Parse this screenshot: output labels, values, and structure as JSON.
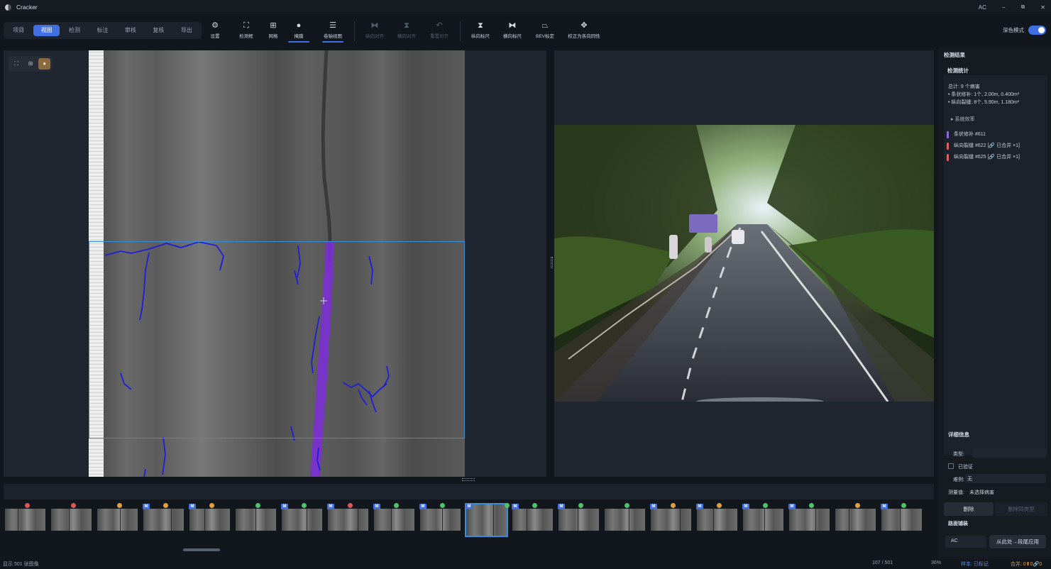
{
  "app": {
    "title": "Cracker",
    "user": "AC"
  },
  "window_controls": {
    "minimize": "−",
    "maximize": "⧉",
    "close": "✕"
  },
  "tabs": [
    {
      "label": "项目",
      "active": false
    },
    {
      "label": "视图",
      "active": true
    },
    {
      "label": "检测",
      "active": false
    },
    {
      "label": "标注",
      "active": false
    },
    {
      "label": "审核",
      "active": false
    },
    {
      "label": "复核",
      "active": false
    },
    {
      "label": "导出",
      "active": false
    }
  ],
  "tools": {
    "settings": "设置",
    "detect_box": "检测框",
    "grid": "网格",
    "mask": "掩膜",
    "roll_view": "卷轴视图",
    "long_align": "纵向对齐",
    "cross_align": "横向对齐",
    "reset_align": "重置对齐",
    "long_ruler": "纵向标尺",
    "cross_ruler": "横向标尺",
    "bev_calib": "BEV标定",
    "correct_to_normal": "校正为各向同性"
  },
  "dark_mode": {
    "label": "深色模式",
    "on": true
  },
  "sidebar": {
    "header": "检测结果",
    "stats_title": "检测统计",
    "total": "总计: 9 个病害",
    "line1": "• 条状修补: 1个, 2.00m, 0.400m²",
    "line2": "• 纵向裂缝: 8个, 5.90m, 1.180m²",
    "efficiency": "▸  系统效率",
    "defects": [
      {
        "label": "条状修补 #611",
        "color": "#8a6bd6"
      },
      {
        "label": "纵向裂缝 #622  [🔗 已合并 ×1]",
        "color": "#e0605e"
      },
      {
        "label": "纵向裂缝 #625  [🔗 已合并 ×1]",
        "color": "#e0605e"
      }
    ],
    "detail_title": "详细信息",
    "type_label": "类型:",
    "verified_label": "已验证",
    "difficulty_label": "难例:",
    "difficulty_value": "无",
    "measure_label": "测量值:",
    "measure_value": "未选择病害",
    "delete_btn": "删除",
    "delete_same_btn": "删除同类型",
    "pavement_title": "路面铺装",
    "pavement_value": "AC",
    "apply_btn": "从此处→段尾应用"
  },
  "thumb_status_colors": {
    "red": "#e05555",
    "orange": "#e0a040",
    "green": "#4cc46a"
  },
  "thumb_badge": "M",
  "thumbnails": [
    {
      "dot": "red",
      "badge": false
    },
    {
      "dot": "red",
      "badge": false
    },
    {
      "dot": "orange",
      "badge": false
    },
    {
      "dot": "orange",
      "badge": true
    },
    {
      "dot": "orange",
      "badge": true
    },
    {
      "dot": "green",
      "badge": false
    },
    {
      "dot": "green",
      "badge": true
    },
    {
      "dot": "red",
      "badge": true
    },
    {
      "dot": "green",
      "badge": true
    },
    {
      "dot": "green",
      "badge": true
    },
    {
      "dot": "green",
      "badge": true,
      "selected": true
    },
    {
      "dot": "green",
      "badge": true
    },
    {
      "dot": "green",
      "badge": true
    },
    {
      "dot": "green",
      "badge": false
    },
    {
      "dot": "orange",
      "badge": true
    },
    {
      "dot": "orange",
      "badge": true
    },
    {
      "dot": "green",
      "badge": true
    },
    {
      "dot": "green",
      "badge": true
    },
    {
      "dot": "orange",
      "badge": false
    },
    {
      "dot": "green",
      "badge": true
    }
  ],
  "status": {
    "shown": "显示 501 张图像",
    "position": "107 / 501",
    "zoom": "36%",
    "sample": "样本: 已标记",
    "merge": "合并: 0",
    "merge_up": "0",
    "merge_link": "0"
  }
}
